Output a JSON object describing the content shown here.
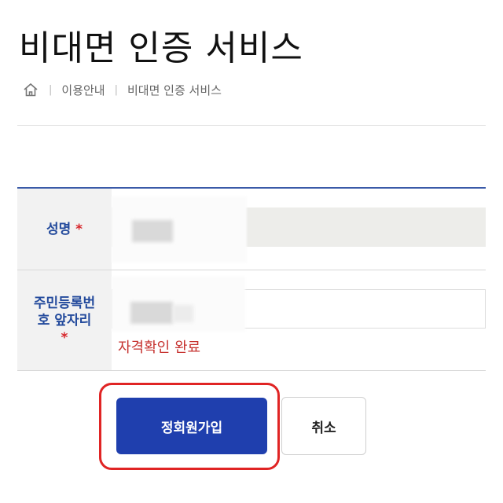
{
  "page": {
    "title": "비대면 인증 서비스"
  },
  "breadcrumb": {
    "home_icon": "home-icon",
    "items": [
      "이용안내",
      "비대면 인증 서비스"
    ],
    "separator": "|"
  },
  "form": {
    "name": {
      "label": "성명",
      "required_mark": "*",
      "value": ""
    },
    "rrn": {
      "label_line1": "주민등록번",
      "label_line2": "호 앞자리",
      "required_mark": "*",
      "value": "",
      "status": "자격확인 완료"
    }
  },
  "buttons": {
    "signup_label": "정회원가입",
    "cancel_label": "취소"
  },
  "colors": {
    "primary": "#1f3fae",
    "label_text": "#234a9c",
    "required": "#d7262b",
    "status": "#c6322f",
    "highlight": "#e02424"
  }
}
